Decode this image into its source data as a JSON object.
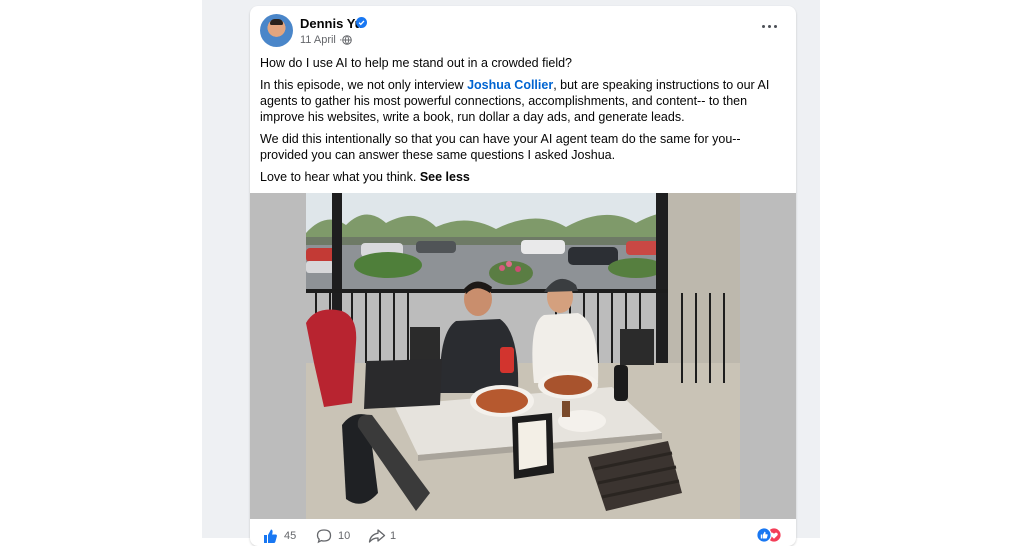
{
  "post": {
    "author": "Dennis Yu",
    "date": "11 April",
    "date_separator": "·",
    "paragraphs": {
      "p1": "How do I use AI to help me stand out in a crowded field?",
      "p2_before": "In this episode, we not only interview ",
      "p2_link": "Joshua Collier",
      "p2_after": ", but are speaking instructions to our AI agents to gather his most powerful connections, accomplishments, and content-- to then improve his websites, write a book, run dollar a day ads, and generate leads.",
      "p3": "We did this intentionally so that you can have your AI agent team do the same for you-- provided you can answer these same questions I asked Joshua.",
      "p4": "Love to hear what you think. ",
      "see_less": "See less"
    }
  },
  "footer": {
    "likes": "45",
    "comments": "10",
    "shares": "1"
  },
  "icons": {
    "verified": "verified-badge-icon",
    "privacy": "globe-icon",
    "menu": "more-options-icon",
    "like": "thumbs-up-icon",
    "comment": "comment-icon",
    "share": "share-icon",
    "reactions": [
      "like-reaction-icon",
      "love-reaction-icon"
    ]
  },
  "colors": {
    "link": "#0064d1",
    "like_blue": "#1877f2",
    "love_red": "#f33e58",
    "meta_grey": "#65676b"
  }
}
